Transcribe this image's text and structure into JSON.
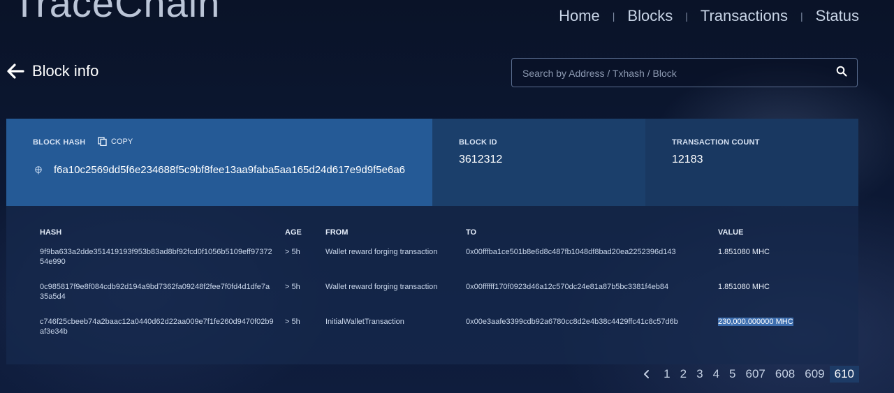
{
  "header": {
    "logo": "TraceChain",
    "nav": [
      "Home",
      "Blocks",
      "Transactions",
      "Status"
    ]
  },
  "page": {
    "title": "Block info"
  },
  "search": {
    "placeholder": "Search by Address / Txhash / Block"
  },
  "block": {
    "hash_label": "BLOCK HASH",
    "copy_label": "COPY",
    "hash": "f6a10c2569dd5f6e234688f5c9bf8fee13aa9faba5aa165d24d617e9d9f5e6a6",
    "id_label": "BLOCK ID",
    "id": "3612312",
    "count_label": "TRANSACTION COUNT",
    "count": "12183"
  },
  "table": {
    "headers": [
      "HASH",
      "AGE",
      "FROM",
      "TO",
      "VALUE"
    ],
    "rows": [
      {
        "hash": "9f9ba633a2dde351419193f953b83ad8bf92fcd0f1056b5109eff9737254e990",
        "age": "> 5h",
        "from": "Wallet reward forging transaction",
        "to": "0x00fffba1ce501b8e6d8c487fb1048df8bad20ea2252396d143",
        "value": "1.851080 MHC"
      },
      {
        "hash": "0c985817f9e8f084cdb92d194a9bd7362fa09248f2fee7f0fd4d1dfe7a35a5d4",
        "age": "> 5h",
        "from": "Wallet reward forging transaction",
        "to": "0x00ffffff170f0923d46a12c570dc24e81a87b5bc3381f4eb84",
        "value": "1.851080 MHC"
      },
      {
        "hash": "c746f25cbeeb74a2baac12a0440d62d22aa009e7f1fe260d9470f02b9af3e34b",
        "age": "> 5h",
        "from": "InitialWalletTransaction",
        "to": "0x00e3aafe3399cdb92a6780cc8d2e4b38c4429ffc41c8c57d6b",
        "value": "230,000.000000 MHC"
      }
    ]
  },
  "pagination": {
    "pages": [
      "1",
      "2",
      "3",
      "4",
      "5",
      "607",
      "608",
      "609",
      "610"
    ],
    "active": "610"
  },
  "icons": [
    "back-arrow-icon",
    "search-icon",
    "copy-icon",
    "hash-icon",
    "chevron-left-icon"
  ],
  "colors": {
    "background": "#0c1833",
    "hash_card": "#255a96",
    "id_card": "#1b3f6b",
    "count_card": "#193861",
    "highlight": "#3e6fb0"
  }
}
